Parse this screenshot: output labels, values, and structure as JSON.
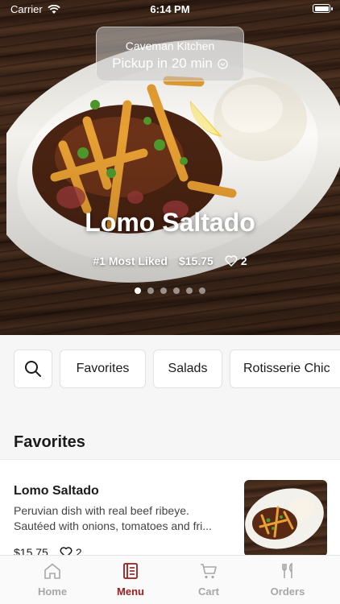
{
  "status_bar": {
    "carrier": "Carrier",
    "time": "6:14 PM"
  },
  "pickup": {
    "restaurant": "Caveman Kitchen",
    "eta": "Pickup in 20 min"
  },
  "hero": {
    "dish_name": "Lomo Saltado",
    "badge": "#1 Most Liked",
    "price": "$15.75",
    "likes": "2",
    "carousel": {
      "count": 6,
      "active_index": 0
    }
  },
  "categories": {
    "search_icon": "search-icon",
    "items": [
      "Favorites",
      "Salads",
      "Rotisserie Chic"
    ]
  },
  "favorites": {
    "title": "Favorites",
    "items": [
      {
        "name": "Lomo Saltado",
        "description_line1": "Peruvian dish with real beef ribeye.",
        "description_line2": "Sautéed with onions, tomatoes and fri...",
        "price": "$15.75",
        "likes": "2"
      }
    ]
  },
  "tabbar": {
    "active": "Menu",
    "tabs": [
      {
        "label": "Home",
        "icon": "home-icon"
      },
      {
        "label": "Menu",
        "icon": "menu-book-icon"
      },
      {
        "label": "Cart",
        "icon": "cart-icon"
      },
      {
        "label": "Orders",
        "icon": "fork-knife-icon"
      }
    ]
  },
  "colors": {
    "accent": "#9c1c1c",
    "inactive_tab": "#a7a7a7",
    "background": "#f6f6f6"
  }
}
